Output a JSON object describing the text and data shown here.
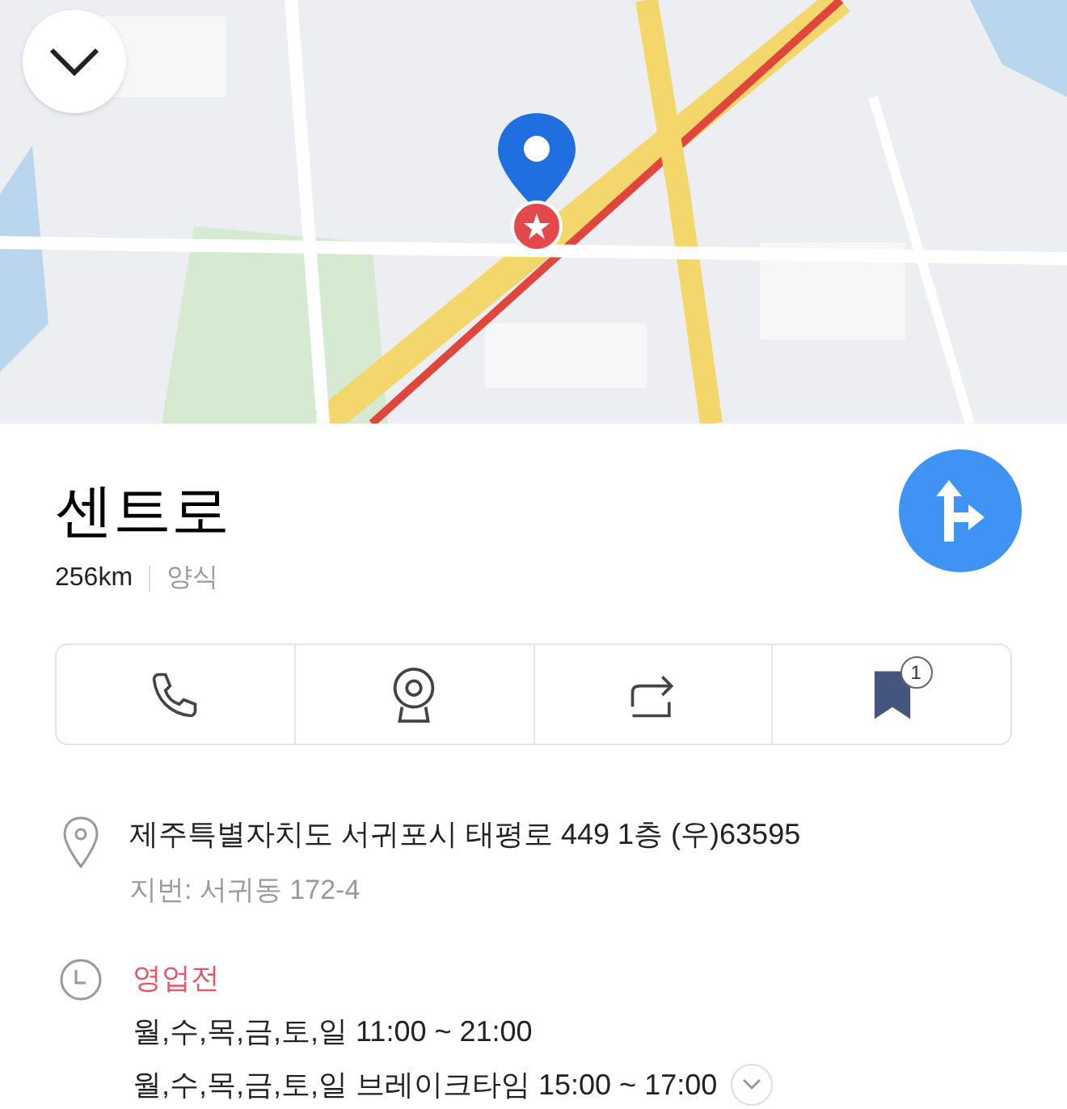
{
  "place": {
    "name": "센트로",
    "distance": "256km",
    "category": "양식"
  },
  "actions": [
    {
      "kind": "call"
    },
    {
      "kind": "camera"
    },
    {
      "kind": "share"
    },
    {
      "kind": "bookmark",
      "badge": "1"
    }
  ],
  "address": {
    "road": "제주특별자치도 서귀포시 태평로 449 1층 (우)63595",
    "lot": "지번: 서귀동 172-4"
  },
  "hours": {
    "status": "영업전",
    "lines": [
      "월,수,목,금,토,일 11:00 ~ 21:00",
      "월,수,목,금,토,일 브레이크타임 15:00 ~ 17:00"
    ],
    "expanded": false
  }
}
